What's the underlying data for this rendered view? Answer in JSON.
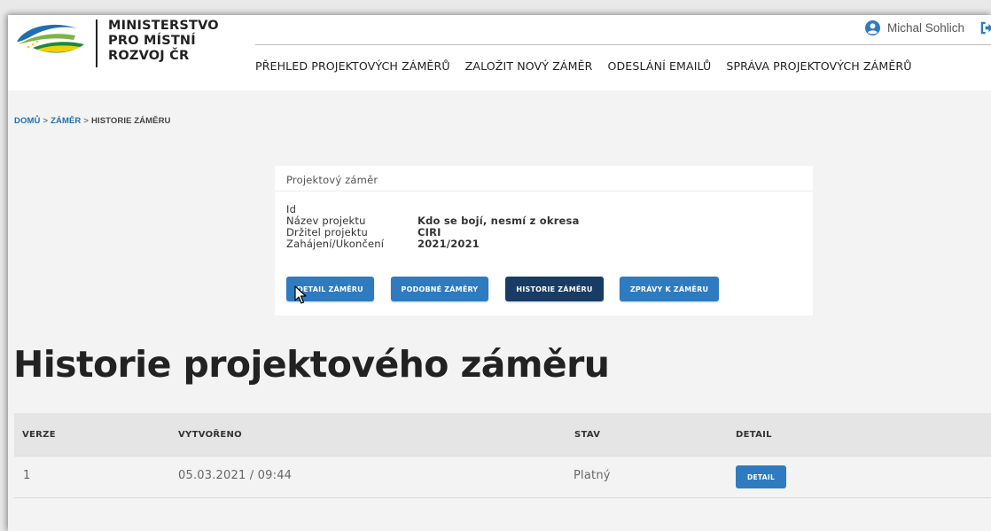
{
  "header": {
    "logo_lines": [
      "MINISTERSTVO",
      "PRO MÍSTNÍ",
      "ROZVOJ ČR"
    ],
    "user_name": "Michal Sohlich",
    "icons": {
      "user": "user-circle-icon",
      "logout": "logout-icon"
    }
  },
  "nav": {
    "items": [
      "PŘEHLED PROJEKTOVÝCH ZÁMĚRŮ",
      "ZALOŽIT NOVÝ ZÁMĚR",
      "ODESLÁNÍ EMAILŮ",
      "SPRÁVA PROJEKTOVÝCH ZÁMĚRŮ"
    ]
  },
  "breadcrumb": {
    "items": [
      "DOMŮ",
      "ZÁMĚR",
      "HISTORIE ZÁMĚRU"
    ],
    "separator": ">"
  },
  "card": {
    "title": "Projektový záměr",
    "fields": [
      {
        "label": "Id",
        "value": ""
      },
      {
        "label": "Název projektu",
        "value": "Kdo se bojí, nesmí z okresa"
      },
      {
        "label": "Držitel projektu",
        "value": "CIRI"
      },
      {
        "label": "Zahájení/Ukončení",
        "value": "2021/2021"
      }
    ],
    "buttons": [
      "DETAIL ZÁMĚRU",
      "PODOBNÉ ZÁMĚRY",
      "HISTORIE ZÁMĚRU",
      "ZPRÁVY K ZÁMĚRU"
    ]
  },
  "page_title": "Historie projektového záměru",
  "table": {
    "headers": [
      "VERZE",
      "VYTVOŘENO",
      "STAV",
      "DETAIL"
    ],
    "rows": [
      {
        "verze": "1",
        "vytvoreno": "05.03.2021 / 09:44",
        "stav": "Platný",
        "detail_label": "DETAIL"
      }
    ]
  },
  "colors": {
    "primary_button": "#2f7bbf",
    "active_button": "#183c64",
    "link": "#1f6fb2",
    "user_icon": "#2f7bbf"
  }
}
